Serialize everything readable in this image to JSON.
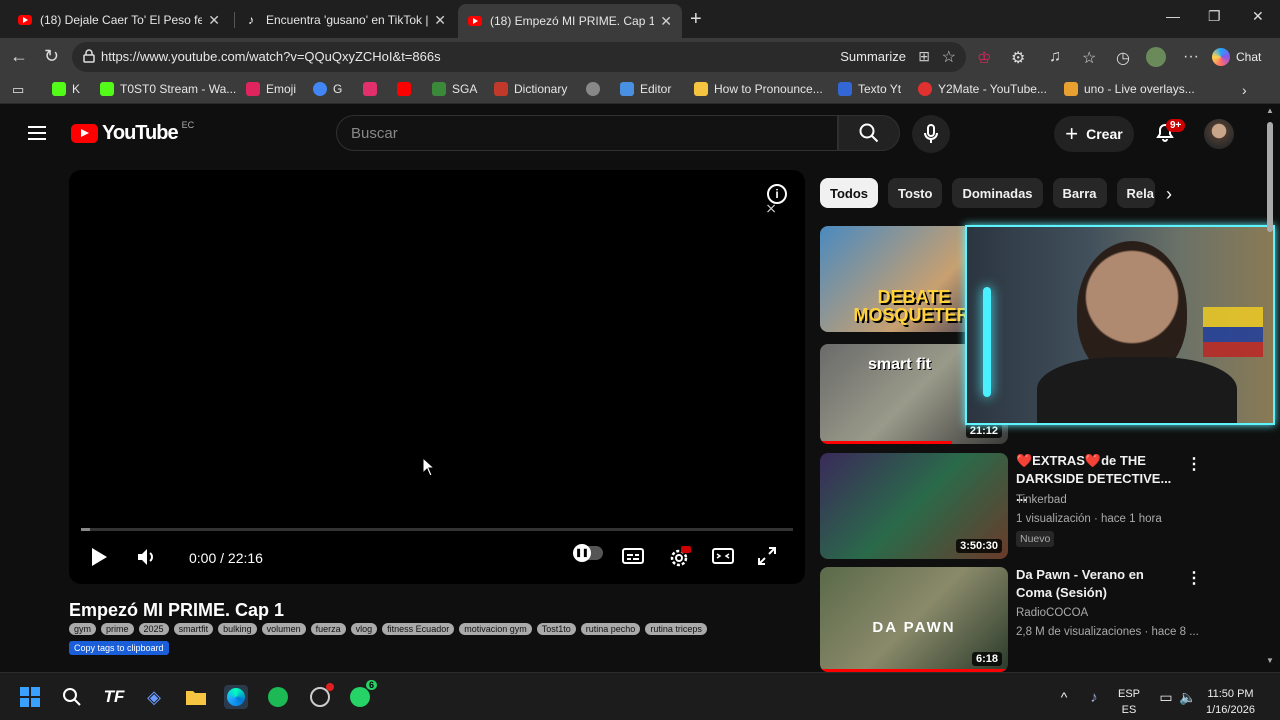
{
  "browser": {
    "tabs": [
      {
        "title": "(18) Dejale Caer To' El Peso feat. H",
        "favicon": "youtube-icon"
      },
      {
        "title": "Encuentra 'gusano' en TikTok | Bus",
        "favicon": "tiktok-icon"
      },
      {
        "title": "(18) Empezó MI PRIME. Cap 1 - Yo",
        "favicon": "youtube-icon",
        "active": true
      }
    ],
    "url": "https://www.youtube.com/watch?v=QQuQxyZCHoI&t=866s",
    "summarize_label": "Summarize",
    "chat_label": "Chat",
    "bookmarks": [
      {
        "label": "K",
        "color": "#53fc18"
      },
      {
        "label": "T0ST0 Stream - Wa...",
        "color": "#53fc18"
      },
      {
        "label": "Emoji",
        "color": "#e0245e"
      },
      {
        "label": "G",
        "color": "#4285f4"
      },
      {
        "label": "",
        "color": "#e1306c"
      },
      {
        "label": "",
        "color": "#ff0000"
      },
      {
        "label": "SGA",
        "color": "#3a8a3a"
      },
      {
        "label": "Dictionary",
        "color": "#c0392b"
      },
      {
        "label": "",
        "color": "#888888"
      },
      {
        "label": "Editor",
        "color": "#4a90e2"
      },
      {
        "label": "How to Pronounce...",
        "color": "#f5c542"
      },
      {
        "label": "Texto Yt",
        "color": "#3367d6"
      },
      {
        "label": "Y2Mate - YouTube...",
        "color": "#e03030"
      },
      {
        "label": "uno - Live overlays...",
        "color": "#e8a030"
      }
    ]
  },
  "youtube": {
    "logo_text": "YouTube",
    "country_code": "EC",
    "search_placeholder": "Buscar",
    "create_label": "Crear",
    "notif_badge": "9+",
    "player": {
      "current_time": "0:00",
      "duration": "22:16",
      "time_display": "0:00 / 22:16",
      "progress_fraction": 0.013
    },
    "video_title": "Empezó MI PRIME. Cap 1",
    "tags": [
      "gym",
      "prime",
      "2025",
      "smartfit",
      "bulking",
      "volumen",
      "fuerza",
      "vlog",
      "fitness Ecuador",
      "motivacion gym",
      "Tost1to",
      "rutina pecho",
      "rutina triceps"
    ],
    "copy_tags_label": "Copy tags to clipboard",
    "chips": [
      "Todos",
      "Tosto",
      "Dominadas",
      "Barra",
      "Rela"
    ],
    "recommendations": [
      {
        "thumb_text": "DEBATE MOSQUETERI",
        "duration": "",
        "title": "",
        "channel": "",
        "meta": ""
      },
      {
        "thumb_text": "smart fit",
        "duration": "21:12",
        "title": "",
        "channel": "",
        "meta": ""
      },
      {
        "thumb_text": "",
        "duration": "3:50:30",
        "title": "❤️EXTRAS❤️de THE DARKSIDE DETECTIVE... ...",
        "channel": "Tinkerbad",
        "meta": "1 visualización · hace 1 hora",
        "badge": "Nuevo"
      },
      {
        "thumb_text": "DA PAWN",
        "duration": "6:18",
        "title": "Da Pawn - Verano en Coma (Sesión)",
        "channel": "RadioCOCOA",
        "meta": "2,8 M de visualizaciones · hace 8 ..."
      }
    ]
  },
  "taskbar": {
    "lang_top": "ESP",
    "lang_bottom": "ES",
    "time": "11:50 PM",
    "date": "1/16/2026",
    "whatsapp_badge": "6"
  }
}
